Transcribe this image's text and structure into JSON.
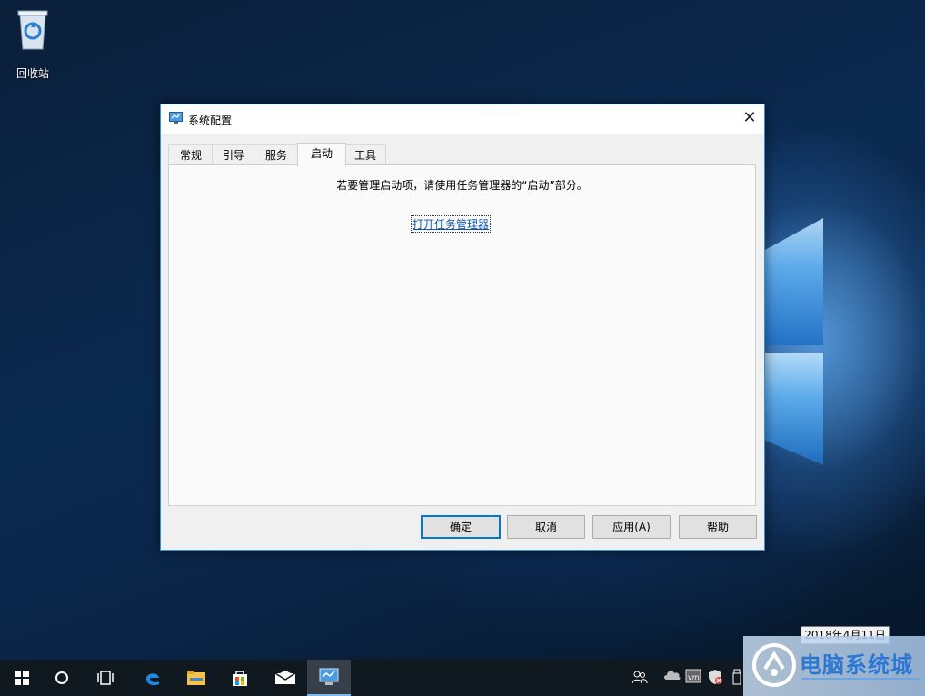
{
  "desktop": {
    "recycle_bin_label": "回收站"
  },
  "dialog": {
    "title": "系统配置",
    "close_glyph": "✕",
    "tabs": [
      {
        "label": "常规"
      },
      {
        "label": "引导"
      },
      {
        "label": "服务"
      },
      {
        "label": "启动"
      },
      {
        "label": "工具"
      }
    ],
    "active_tab": "启动",
    "panel": {
      "info_text": "若要管理启动项，请使用任务管理器的“启动”部分。",
      "link_text": "打开任务管理器"
    },
    "buttons": {
      "ok": "确定",
      "cancel": "取消",
      "apply": "应用(A)",
      "help": "帮助"
    }
  },
  "date_tooltip": "2018年4月11日",
  "taskbar": {
    "items": [
      "start-icon",
      "cortana-icon",
      "task-view-icon",
      "edge-icon",
      "file-explorer-icon",
      "store-icon",
      "mail-icon",
      "msconfig-icon"
    ],
    "active_item": "msconfig-icon",
    "tray": [
      "people-icon",
      "onedrive-icon",
      "vmware-icon",
      "defender-icon",
      "usb-icon"
    ]
  },
  "watermark": {
    "text": "电脑系统城"
  },
  "colors": {
    "accent": "#0078d7",
    "link": "#1155aa",
    "taskbar": "#101820"
  }
}
